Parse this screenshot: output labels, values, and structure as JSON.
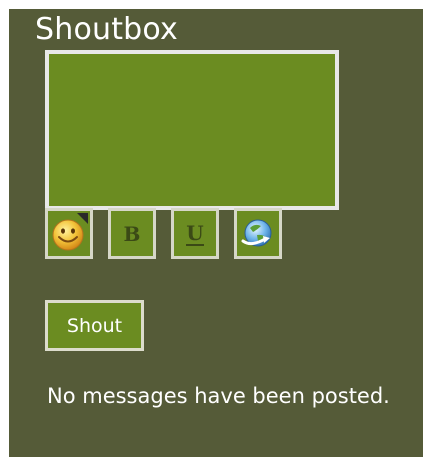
{
  "shoutbox": {
    "title": "Shoutbox",
    "message_input": {
      "value": "",
      "placeholder": ""
    },
    "toolbar": [
      {
        "name": "smiley-button",
        "icon": "smiley-icon"
      },
      {
        "name": "bold-button",
        "label": "B",
        "icon": "bold-icon"
      },
      {
        "name": "underline-button",
        "label": "U",
        "icon": "underline-icon"
      },
      {
        "name": "insert-link-button",
        "icon": "link-globe-icon"
      }
    ],
    "shout_button_label": "Shout",
    "empty_message": "No messages have been posted."
  },
  "colors": {
    "panel": "#555b38",
    "accent": "#6b8c21",
    "border": "#e8e8e8",
    "text": "#ffffff"
  }
}
